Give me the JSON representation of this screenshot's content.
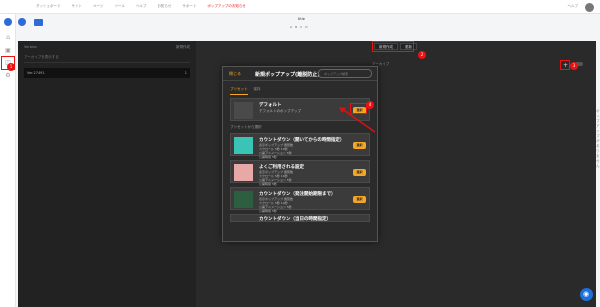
{
  "topbar": {
    "nav": [
      "ダッシュボード",
      "サイト",
      "ページ",
      "ツール",
      "ヘルプ",
      "お知らせ",
      "サポート",
      "ポップアップのお知らせ"
    ],
    "right_text": "ヘルプ"
  },
  "sidebar": {
    "icons": [
      "home-icon",
      "popup-icon",
      "tag-icon",
      "settings-icon"
    ]
  },
  "header": {
    "title": "title",
    "subtitle": [
      "A",
      "B",
      "C",
      "D"
    ]
  },
  "left_panel": {
    "header": {
      "left": "Version",
      "right": "新規作成"
    },
    "search": "アーカイブを表示する",
    "item": {
      "label": "Ver.27491",
      "count": "1"
    }
  },
  "right_panel": {
    "tabs": [
      "新規作成",
      "更新"
    ],
    "header": "アーカイブ",
    "message": "ポップアップがありません",
    "toggle_label": "OFF"
  },
  "modal": {
    "back": "閉じる",
    "title": "新規ポップアップ(離脱防止)",
    "search_placeholder": "ポップアップ検索",
    "tabs": [
      "プリセット",
      "保存"
    ],
    "default_card": {
      "title": "デフォルト",
      "sub": "デフォルトのポップアップ"
    },
    "section_label": "プリセットから選択",
    "cards": [
      {
        "title": "カウントダウン（開いてからの時間指定）",
        "line1": "表示ポップアップ 閲覧数",
        "line2": "スクロール 5秒  10秒",
        "line3": "公開アニメーション 5秒",
        "line4": "公開時間 5秒"
      },
      {
        "title": "よくご利用される設定",
        "line1": "表示ポップアップ 閲覧数",
        "line2": "スクロール 5秒  10秒",
        "line3": "公開アニメーション 5秒",
        "line4": "公開時間 5秒"
      },
      {
        "title": "カウントダウン（発注開始期限まで）",
        "line1": "表示ポップアップ 閲覧数",
        "line2": "スクロール 5秒  10秒",
        "line3": "公開アニメーション 5秒",
        "line4": "公開時間 5秒"
      },
      {
        "title": "カウントダウン（当日の時間指定）"
      }
    ],
    "select_label": "選択"
  },
  "markers": [
    "1",
    "2",
    "3",
    "4"
  ]
}
